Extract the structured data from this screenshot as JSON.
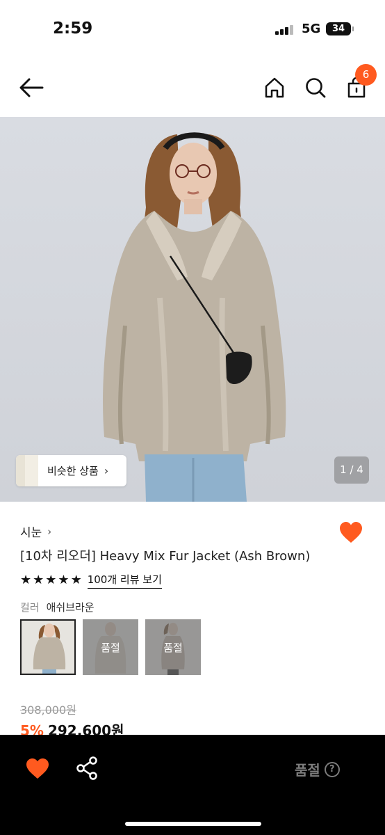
{
  "status": {
    "time": "2:59",
    "network": "5G",
    "battery": "34"
  },
  "header": {
    "cart_count": "6"
  },
  "gallery": {
    "similar_label": "비슷한 상품",
    "page": "1 / 4"
  },
  "product": {
    "brand": "시눈",
    "title": "[10차 리오더] Heavy Mix Fur Jacket (Ash Brown)",
    "rating_stars": 5,
    "review_link": "100개 리뷰 보기",
    "color_label": "컬러",
    "color_value": "애쉬브라운",
    "swatches": [
      {
        "selected": true,
        "overlay": ""
      },
      {
        "selected": false,
        "overlay": "품절"
      },
      {
        "selected": false,
        "overlay": "품절"
      }
    ],
    "original_price": "308,000원",
    "discount": "5%",
    "price": "292,600원"
  },
  "bottom": {
    "soldout_label": "품절",
    "help_icon": "?"
  },
  "colors": {
    "accent": "#ff5a1f",
    "bottom_bar": "#000000"
  }
}
